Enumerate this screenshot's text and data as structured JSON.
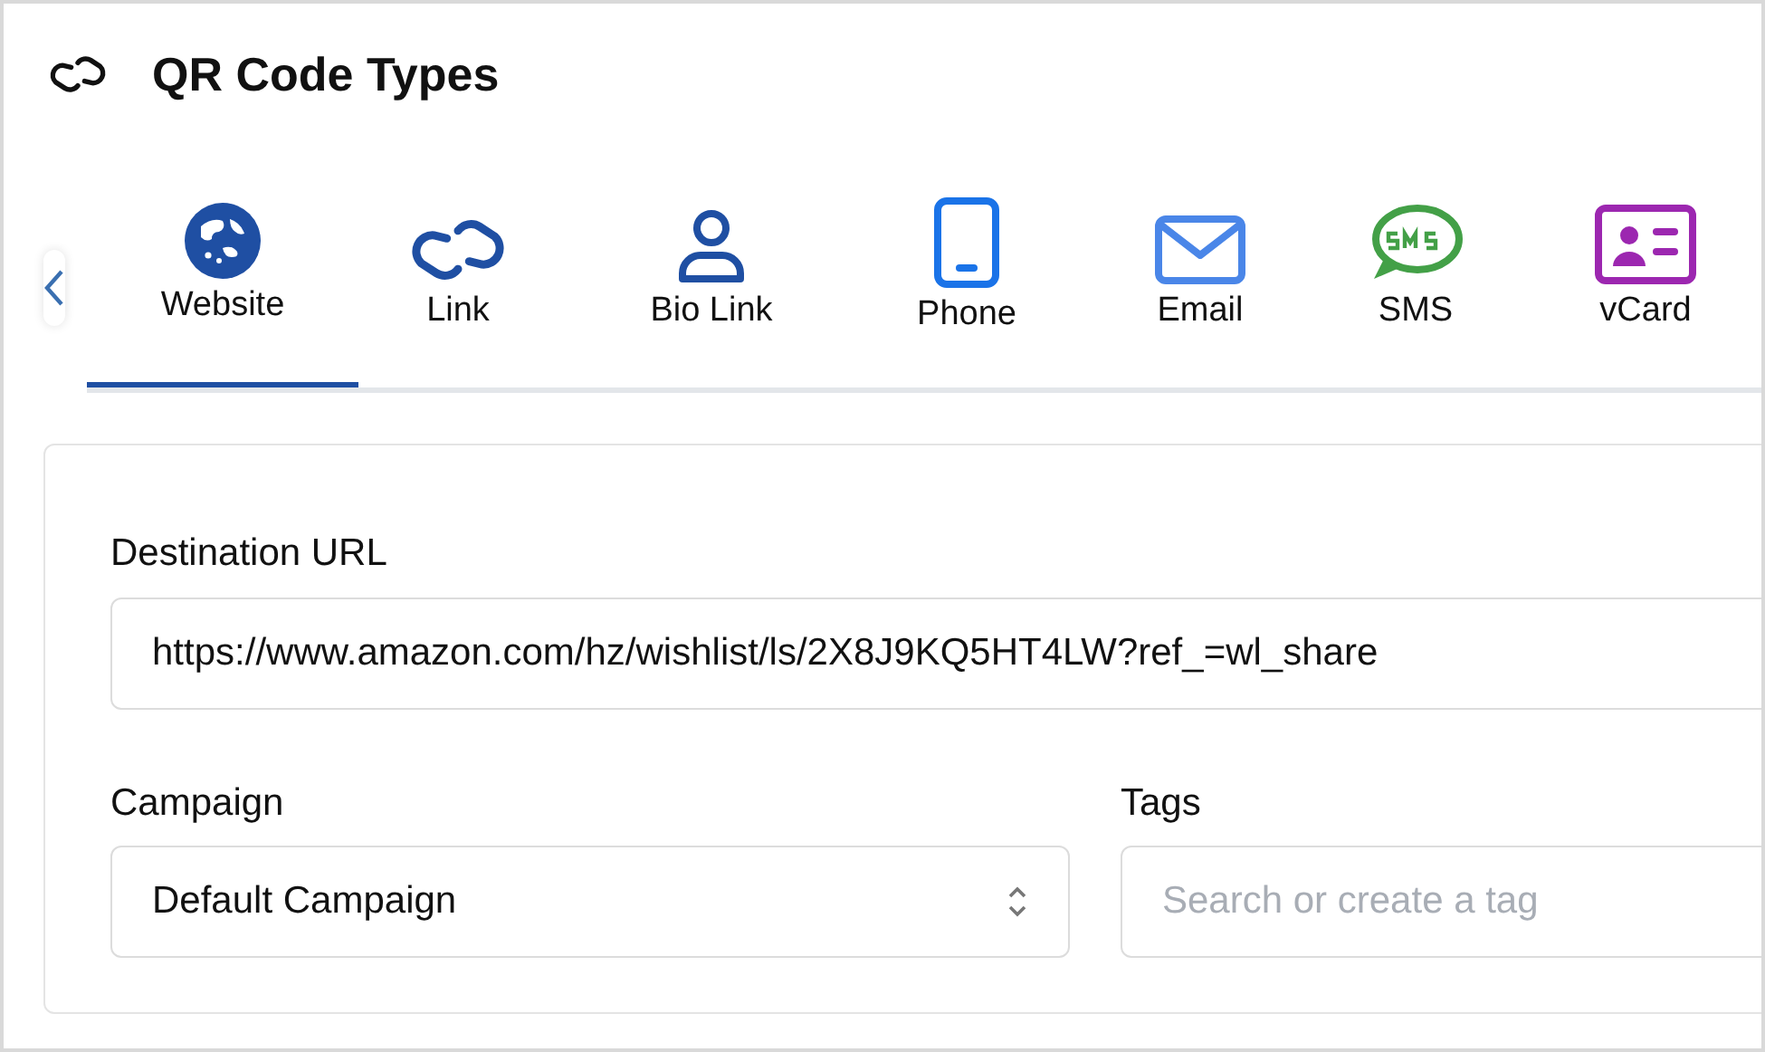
{
  "header": {
    "title": "QR Code Types"
  },
  "tabs": [
    {
      "label": "Website",
      "kind": "globe",
      "selected": true
    },
    {
      "label": "Link",
      "kind": "link",
      "selected": false
    },
    {
      "label": "Bio Link",
      "kind": "person",
      "selected": false
    },
    {
      "label": "Phone",
      "kind": "phone",
      "selected": false
    },
    {
      "label": "Email",
      "kind": "email",
      "selected": false
    },
    {
      "label": "SMS",
      "kind": "sms",
      "selected": false
    },
    {
      "label": "vCard",
      "kind": "vcard",
      "selected": false
    }
  ],
  "form": {
    "destination": {
      "label": "Destination URL",
      "value": "https://www.amazon.com/hz/wishlist/ls/2X8J9KQ5HT4LW?ref_=wl_share"
    },
    "campaign": {
      "label": "Campaign",
      "value": "Default Campaign"
    },
    "tags": {
      "label": "Tags",
      "placeholder": "Search or create a tag"
    }
  }
}
